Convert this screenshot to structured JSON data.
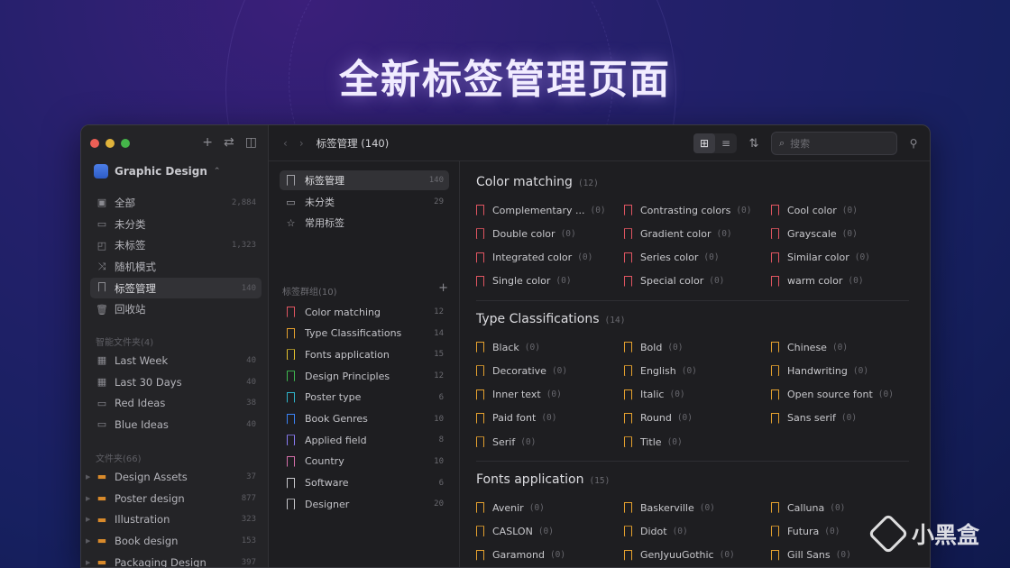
{
  "hero": {
    "title": "全新标签管理页面"
  },
  "watermark": {
    "text": "小黑盒"
  },
  "colors": {
    "tag_red": "#e05561",
    "tag_orange": "#e5a12e",
    "folder": "#d98a2b",
    "accent_blue": "#4c7ee8"
  },
  "sidebar": {
    "library": "Graphic Design",
    "library_icon": "app-icon",
    "items": [
      {
        "label": "全部",
        "count": "2,884",
        "icon": "all-icon"
      },
      {
        "label": "未分类",
        "count": "",
        "icon": "folder-icon"
      },
      {
        "label": "未标签",
        "count": "1,323",
        "icon": "untagged-icon"
      },
      {
        "label": "随机模式",
        "count": "",
        "icon": "shuffle-icon"
      },
      {
        "label": "标签管理",
        "count": "140",
        "icon": "tag-icon"
      },
      {
        "label": "回收站",
        "count": "",
        "icon": "trash-icon"
      }
    ],
    "smart_folders_title": "智能文件夹(4)",
    "smart_folders": [
      {
        "label": "Last Week",
        "count": "40"
      },
      {
        "label": "Last 30 Days",
        "count": "40"
      },
      {
        "label": "Red Ideas",
        "count": "38"
      },
      {
        "label": "Blue Ideas",
        "count": "40"
      }
    ],
    "folders_title": "文件夹(66)",
    "folders": [
      {
        "label": "Design Assets",
        "count": "37"
      },
      {
        "label": "Poster design",
        "count": "877"
      },
      {
        "label": "Illustration",
        "count": "323"
      },
      {
        "label": "Book design",
        "count": "153"
      },
      {
        "label": "Packaging Design",
        "count": "397"
      }
    ]
  },
  "toolbar": {
    "title": "标签管理 (140)",
    "search_placeholder": "搜索"
  },
  "groups_panel": {
    "top": [
      {
        "label": "标签管理",
        "count": "140"
      },
      {
        "label": "未分类",
        "count": "29"
      },
      {
        "label": "常用标签",
        "count": ""
      }
    ],
    "groups_title": "标签群组(10)",
    "groups": [
      {
        "label": "Color matching",
        "count": "12",
        "color": "#e05561"
      },
      {
        "label": "Type Classifications",
        "count": "14",
        "color": "#e5a12e"
      },
      {
        "label": "Fonts application",
        "count": "15",
        "color": "#e5c22e"
      },
      {
        "label": "Design Principles",
        "count": "12",
        "color": "#3fb950"
      },
      {
        "label": "Poster type",
        "count": "6",
        "color": "#2fb3c9"
      },
      {
        "label": "Book Genres",
        "count": "10",
        "color": "#3b82f6"
      },
      {
        "label": "Applied field",
        "count": "8",
        "color": "#8b7cf6"
      },
      {
        "label": "Country",
        "count": "10",
        "color": "#d56fa9"
      },
      {
        "label": "Software",
        "count": "6",
        "color": "#c8c8cc"
      },
      {
        "label": "Designer",
        "count": "20",
        "color": "#c8c8cc"
      }
    ]
  },
  "sections": [
    {
      "title": "Color matching",
      "count": "(12)",
      "tags": [
        {
          "label": "Complementary ...",
          "count": "(0)"
        },
        {
          "label": "Contrasting colors",
          "count": "(0)"
        },
        {
          "label": "Cool color",
          "count": "(0)"
        },
        {
          "label": "Double color",
          "count": "(0)"
        },
        {
          "label": "Gradient color",
          "count": "(0)"
        },
        {
          "label": "Grayscale",
          "count": "(0)"
        },
        {
          "label": "Integrated color",
          "count": "(0)"
        },
        {
          "label": "Series color",
          "count": "(0)"
        },
        {
          "label": "Similar color",
          "count": "(0)"
        },
        {
          "label": "Single color",
          "count": "(0)"
        },
        {
          "label": "Special color",
          "count": "(0)"
        },
        {
          "label": "warm color",
          "count": "(0)"
        }
      ]
    },
    {
      "title": "Type Classifications",
      "count": "(14)",
      "tags": [
        {
          "label": "Black",
          "count": "(0)"
        },
        {
          "label": "Bold",
          "count": "(0)"
        },
        {
          "label": "Chinese",
          "count": "(0)"
        },
        {
          "label": "Decorative",
          "count": "(0)"
        },
        {
          "label": "English",
          "count": "(0)"
        },
        {
          "label": "Handwriting",
          "count": "(0)"
        },
        {
          "label": "Inner text",
          "count": "(0)"
        },
        {
          "label": "Italic",
          "count": "(0)"
        },
        {
          "label": "Open source font",
          "count": "(0)"
        },
        {
          "label": "Paid font",
          "count": "(0)"
        },
        {
          "label": "Round",
          "count": "(0)"
        },
        {
          "label": "Sans serif",
          "count": "(0)"
        },
        {
          "label": "Serif",
          "count": "(0)"
        },
        {
          "label": "Title",
          "count": "(0)"
        }
      ]
    },
    {
      "title": "Fonts application",
      "count": "(15)",
      "tags": [
        {
          "label": "Avenir",
          "count": "(0)"
        },
        {
          "label": "Baskerville",
          "count": "(0)"
        },
        {
          "label": "Calluna",
          "count": "(0)"
        },
        {
          "label": "CASLON",
          "count": "(0)"
        },
        {
          "label": "Didot",
          "count": "(0)"
        },
        {
          "label": "Futura",
          "count": "(0)"
        },
        {
          "label": "Garamond",
          "count": "(0)"
        },
        {
          "label": "GenJyuuGothic",
          "count": "(0)"
        },
        {
          "label": "Gill Sans",
          "count": "(0)"
        }
      ]
    }
  ]
}
